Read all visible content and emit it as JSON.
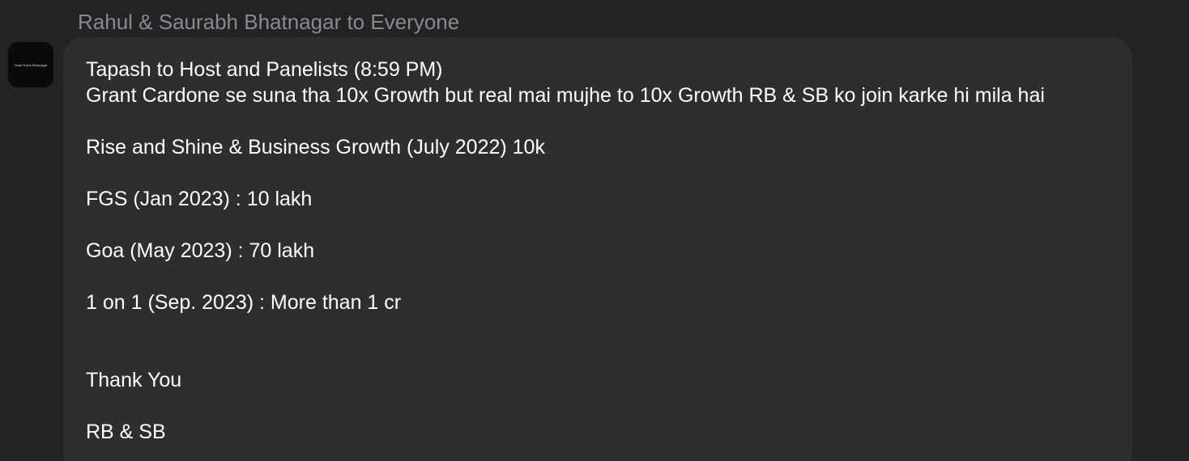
{
  "sender": "Rahul & Saurabh Bhatnagar to Everyone",
  "avatar": {
    "label": "Team Rahul Bhatnagar",
    "background": "#0a0a0a"
  },
  "message": {
    "lines": [
      "Tapash to Host and Panelists (8:59 PM)",
      "Grant Cardone se suna tha 10x Growth but real mai mujhe to 10x Growth RB & SB ko join karke hi mila hai",
      "",
      "Rise and Shine & Business Growth (July 2022) 10k",
      "",
      "FGS (Jan 2023) : 10 lakh",
      "",
      "Goa (May 2023) : 70 lakh",
      "",
      "1 on 1 (Sep. 2023) : More than 1 cr",
      "",
      "",
      "Thank You",
      "",
      "RB & SB"
    ]
  },
  "colors": {
    "background": "#232323",
    "bubble": "#2e2e2e",
    "sender_text": "#8a8896",
    "message_text": "#ffffff"
  }
}
